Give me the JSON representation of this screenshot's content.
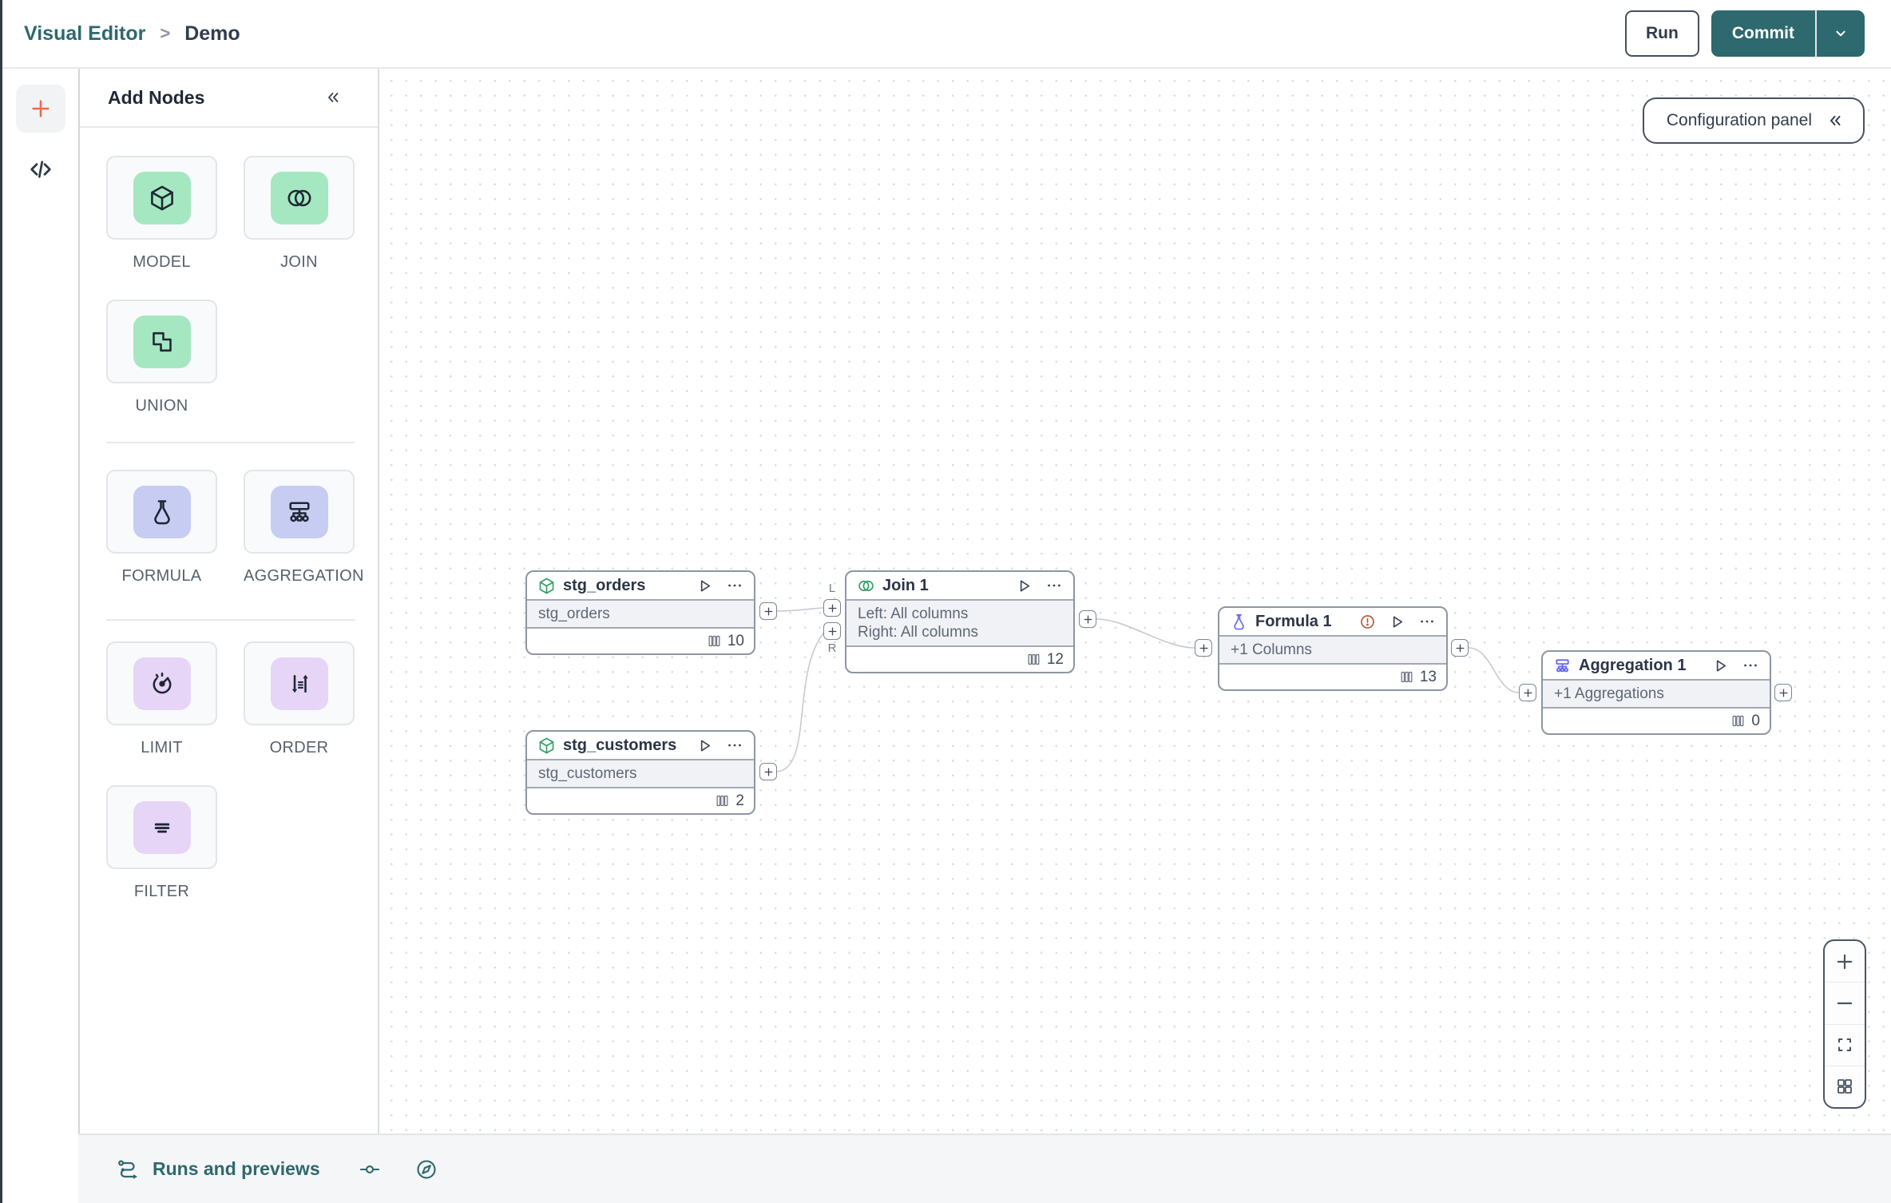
{
  "colors": {
    "teal": "#2d696e",
    "orange": "#ee6a4a",
    "green_bg": "#a5e7c1",
    "lavender_bg": "#c7ccf3",
    "purple_bg": "#e6d5f7",
    "green_icon": "#2f9e62",
    "indigo_icon": "#6366f1",
    "warning": "#b25a3c"
  },
  "topbar": {
    "breadcrumb": {
      "root": "Visual Editor",
      "separator": ">",
      "current": "Demo"
    },
    "run_label": "Run",
    "commit_label": "Commit"
  },
  "add_nodes_panel": {
    "title": "Add Nodes",
    "tiles": [
      {
        "label": "MODEL",
        "icon": "cube-icon"
      },
      {
        "label": "JOIN",
        "icon": "join-circles-icon"
      },
      {
        "label": "UNION",
        "icon": "union-shapes-icon"
      },
      {
        "label": "FORMULA",
        "icon": "flask-icon"
      },
      {
        "label": "AGGREGATION",
        "icon": "hierarchy-icon"
      },
      {
        "label": "LIMIT",
        "icon": "gauge-icon"
      },
      {
        "label": "ORDER",
        "icon": "sort-arrows-icon"
      },
      {
        "label": "FILTER",
        "icon": "filter-lines-icon"
      }
    ]
  },
  "canvas": {
    "configuration_panel_label": "Configuration panel",
    "port_labels": {
      "left": "L",
      "right": "R"
    },
    "nodes": [
      {
        "title": "stg_orders",
        "icon": "cube-icon",
        "body_lines": [
          "stg_orders"
        ],
        "column_count": "10"
      },
      {
        "title": "stg_customers",
        "icon": "cube-icon",
        "body_lines": [
          "stg_customers"
        ],
        "column_count": "2"
      },
      {
        "title": "Join 1",
        "icon": "join-circles-icon",
        "body_lines": [
          "Left: All columns",
          "Right: All columns"
        ],
        "column_count": "12"
      },
      {
        "title": "Formula 1",
        "icon": "flask-icon",
        "body_lines": [
          "+1 Columns"
        ],
        "column_count": "13",
        "has_warning": true
      },
      {
        "title": "Aggregation 1",
        "icon": "hierarchy-icon",
        "body_lines": [
          "+1 Aggregations"
        ],
        "column_count": "0"
      }
    ],
    "zoom_controls": [
      "zoom-in",
      "zoom-out",
      "fit-view",
      "overview"
    ]
  },
  "bottom_bar": {
    "runs_label": "Runs and previews"
  }
}
